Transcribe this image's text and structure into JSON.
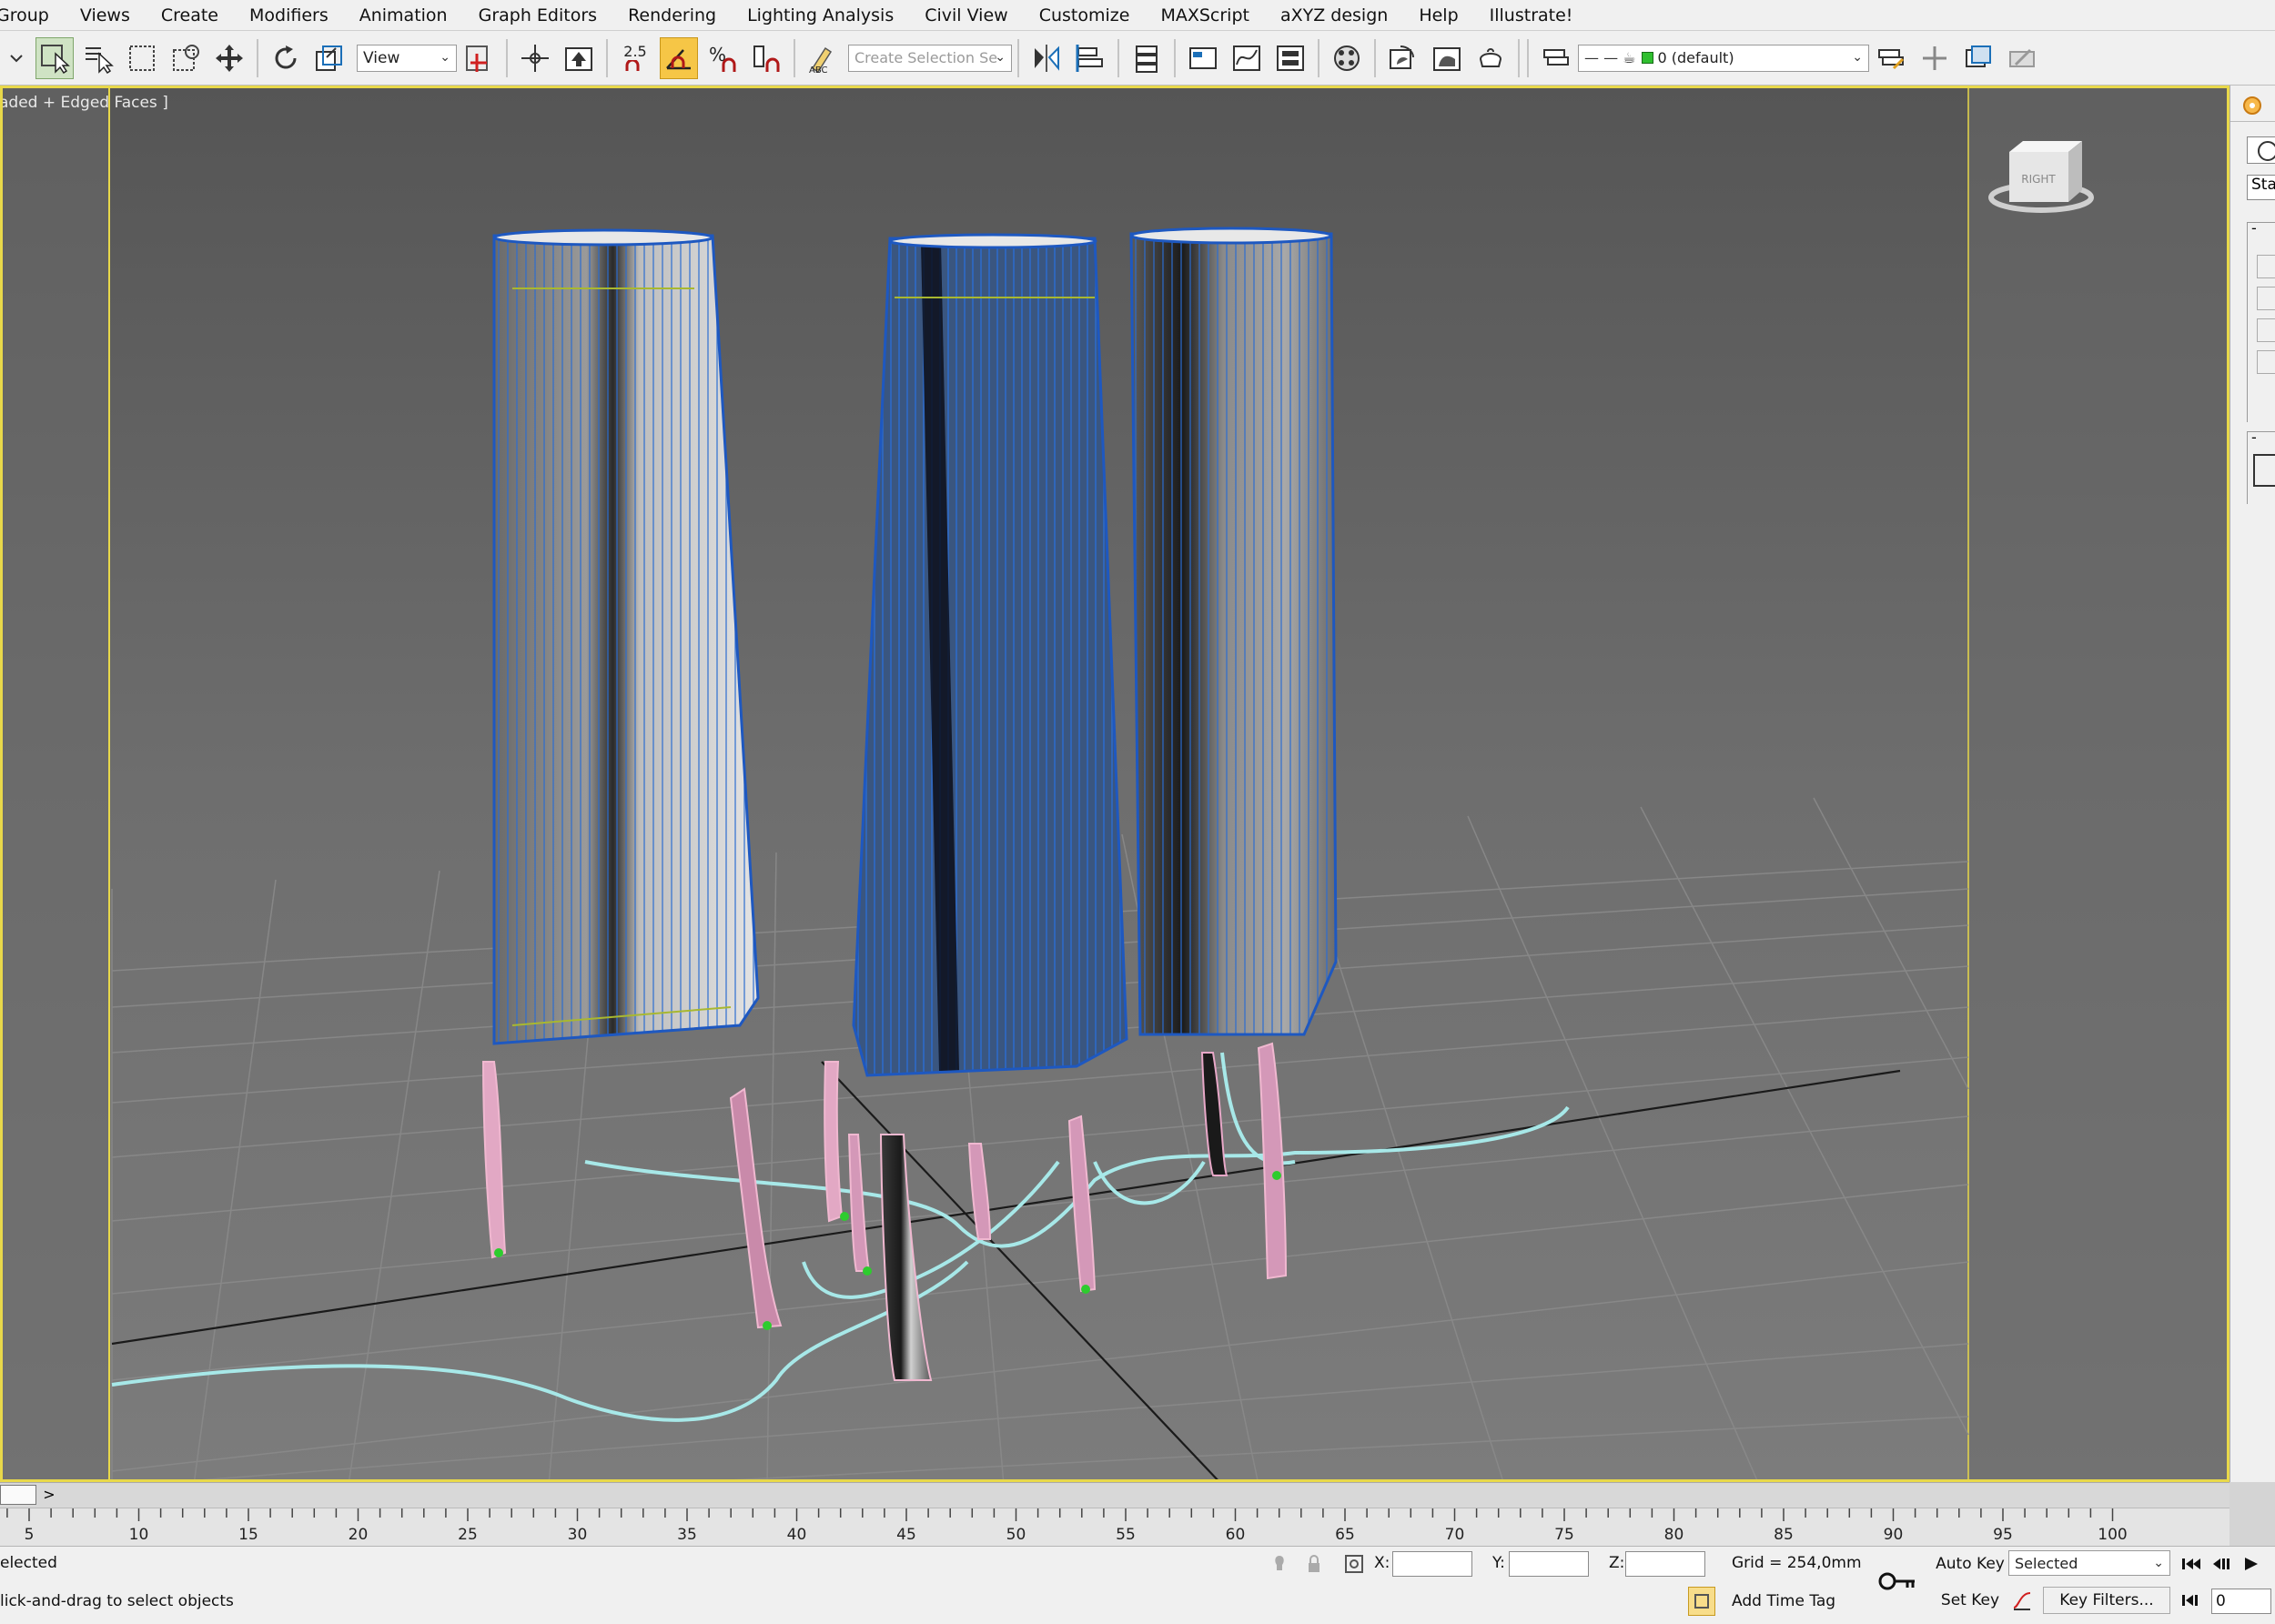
{
  "menu": [
    "Group",
    "Views",
    "Create",
    "Modifiers",
    "Animation",
    "Graph Editors",
    "Rendering",
    "Lighting Analysis",
    "Civil View",
    "Customize",
    "MAXScript",
    "aXYZ design",
    "Help",
    "Illustrate!"
  ],
  "toolbar": {
    "ref_coord": "View",
    "snap_value": "2.5",
    "selection_set_placeholder": "Create Selection Se",
    "layer_name": "0 (default)"
  },
  "viewport": {
    "label": "aded + Edged Faces ]",
    "viewcube_label": "RIGHT"
  },
  "command_panel": {
    "tab_text": "Sta"
  },
  "timeline": {
    "next_label": ">",
    "ticks": [
      "5",
      "10",
      "15",
      "20",
      "25",
      "30",
      "35",
      "40",
      "45",
      "50",
      "55",
      "60",
      "65",
      "70",
      "75",
      "80",
      "85",
      "90",
      "95",
      "100"
    ]
  },
  "status": {
    "selection": "elected",
    "prompt": "lick-and-drag to select objects",
    "x_label": "X:",
    "y_label": "Y:",
    "z_label": "Z:",
    "grid": "Grid = 254,0mm",
    "add_time_tag": "Add Time Tag",
    "auto_key": "Auto Key",
    "set_key": "Set Key",
    "key_mode": "Selected",
    "key_filters": "Key Filters...",
    "frame": "0"
  }
}
